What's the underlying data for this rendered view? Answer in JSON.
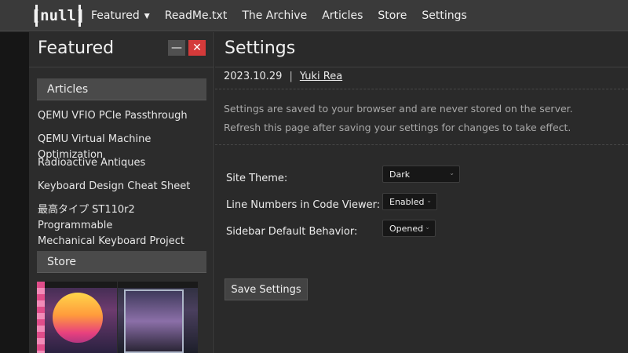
{
  "logo": {
    "text": "[null]"
  },
  "nav": {
    "items": [
      {
        "label": "Featured",
        "has_dropdown": true,
        "dropdown_glyph": "▼"
      },
      {
        "label": "ReadMe.txt"
      },
      {
        "label": "The Archive"
      },
      {
        "label": "Articles"
      },
      {
        "label": "Store"
      },
      {
        "label": "Settings"
      }
    ]
  },
  "sidebar": {
    "title": "Featured",
    "minimize_glyph": "—",
    "close_glyph": "✕",
    "sections": [
      {
        "title": "Articles",
        "links": [
          "QEMU VFIO PCIe Passthrough",
          "QEMU Virtual Machine Optimization",
          "Radioactive Antiques",
          "Keyboard Design Cheat Sheet",
          "最高タイプ ST110r2 Programmable",
          "Mechanical Keyboard Project"
        ]
      },
      {
        "title": "Store"
      }
    ]
  },
  "main": {
    "title": "Settings",
    "date": "2023.10.29",
    "separator": "|",
    "author": "Yuki Rea",
    "description": [
      "Settings are saved to your browser and are never stored on the server.",
      "Refresh this page after saving your settings for changes to take effect."
    ],
    "options": [
      {
        "label": "Site Theme:",
        "value": "Dark"
      },
      {
        "label": "Line Numbers in Code Viewer:",
        "value": "Enabled"
      },
      {
        "label": "Sidebar Default Behavior:",
        "value": "Opened"
      }
    ],
    "select_arrow": "⌄",
    "save_label": "Save Settings"
  },
  "colors": {
    "topbar": "#3a3a3a",
    "background": "#252525",
    "close_button": "#d43a3a",
    "section_header": "#4a4a4a",
    "select_bg": "#171717"
  }
}
